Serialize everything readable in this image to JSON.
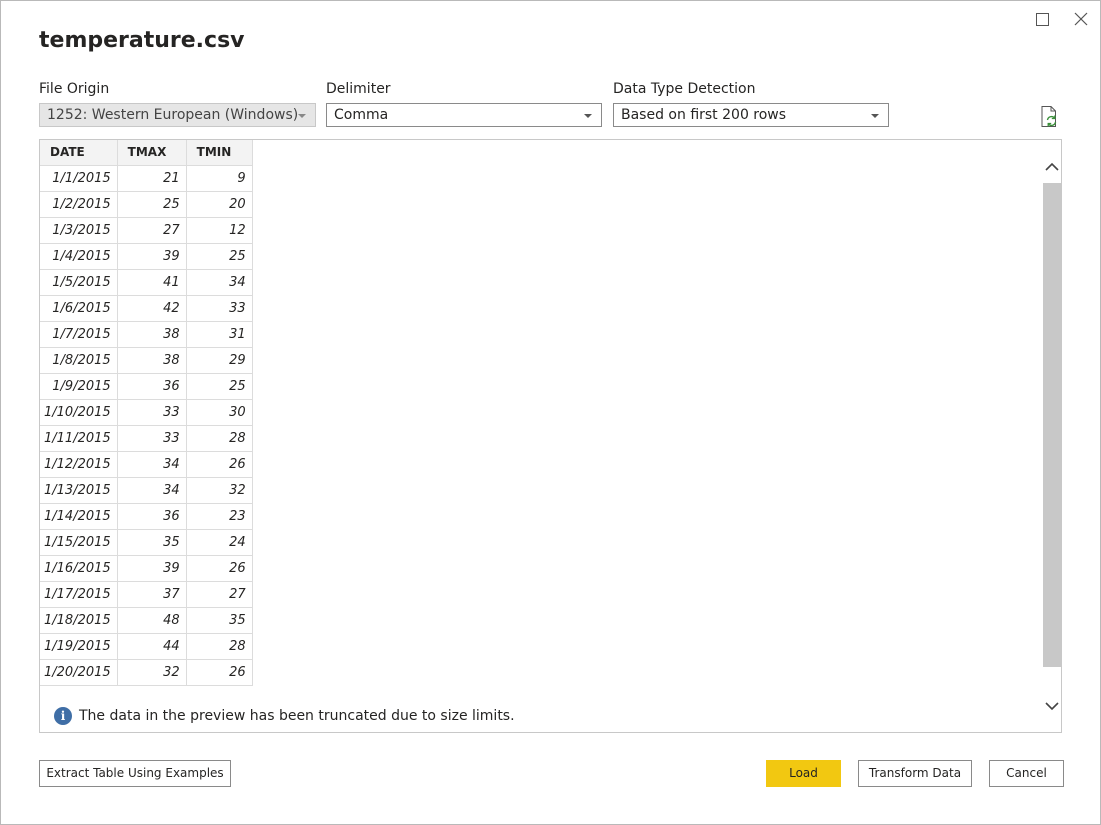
{
  "dialog": {
    "title": "temperature.csv"
  },
  "options": {
    "file_origin": {
      "label": "File Origin",
      "value": "1252: Western European (Windows)"
    },
    "delimiter": {
      "label": "Delimiter",
      "value": "Comma"
    },
    "data_type_detection": {
      "label": "Data Type Detection",
      "value": "Based on first 200 rows"
    }
  },
  "icons": {
    "refresh": "refresh-file-icon",
    "info": "info-icon",
    "info_glyph": "i"
  },
  "table": {
    "columns": [
      "DATE",
      "TMAX",
      "TMIN"
    ],
    "rows": [
      [
        "1/1/2015",
        "21",
        "9"
      ],
      [
        "1/2/2015",
        "25",
        "20"
      ],
      [
        "1/3/2015",
        "27",
        "12"
      ],
      [
        "1/4/2015",
        "39",
        "25"
      ],
      [
        "1/5/2015",
        "41",
        "34"
      ],
      [
        "1/6/2015",
        "42",
        "33"
      ],
      [
        "1/7/2015",
        "38",
        "31"
      ],
      [
        "1/8/2015",
        "38",
        "29"
      ],
      [
        "1/9/2015",
        "36",
        "25"
      ],
      [
        "1/10/2015",
        "33",
        "30"
      ],
      [
        "1/11/2015",
        "33",
        "28"
      ],
      [
        "1/12/2015",
        "34",
        "26"
      ],
      [
        "1/13/2015",
        "34",
        "32"
      ],
      [
        "1/14/2015",
        "36",
        "23"
      ],
      [
        "1/15/2015",
        "35",
        "24"
      ],
      [
        "1/16/2015",
        "39",
        "26"
      ],
      [
        "1/17/2015",
        "37",
        "27"
      ],
      [
        "1/18/2015",
        "48",
        "35"
      ],
      [
        "1/19/2015",
        "44",
        "28"
      ],
      [
        "1/20/2015",
        "32",
        "26"
      ]
    ]
  },
  "notice": "The data in the preview has been truncated due to size limits.",
  "buttons": {
    "extract": "Extract Table Using Examples",
    "load": "Load",
    "transform": "Transform Data",
    "cancel": "Cancel"
  },
  "colors": {
    "primary_button": "#f2c811",
    "info_icon": "#3f6ea6",
    "refresh_icon_accent": "#3a8f3a"
  }
}
